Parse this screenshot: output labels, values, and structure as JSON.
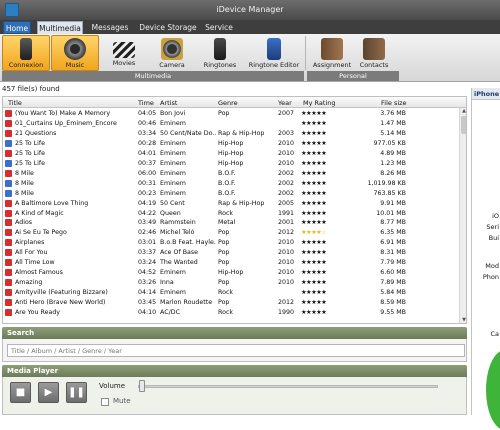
{
  "window": {
    "title": "iDevice Manager"
  },
  "menu": {
    "tabs": [
      "Home",
      "Multimedia",
      "Messages",
      "Device Storage",
      "Service"
    ],
    "active": "Multimedia"
  },
  "ribbon": {
    "buttons": [
      {
        "label": "Connexion",
        "icon": "phone-icon",
        "selected": true
      },
      {
        "label": "Music",
        "icon": "speaker-icon",
        "selected": true
      },
      {
        "label": "Movies",
        "icon": "clapperboard-icon",
        "selected": false
      },
      {
        "label": "Camera",
        "icon": "camera-icon",
        "selected": false
      },
      {
        "label": "Ringtones",
        "icon": "ringtone-phone-icon",
        "selected": false
      },
      {
        "label": "Ringtone Editor",
        "icon": "ringtone-editor-icon",
        "selected": false
      },
      {
        "label": "Assignment",
        "icon": "assignment-book-icon",
        "selected": false
      },
      {
        "label": "Contacts",
        "icon": "contacts-book-icon",
        "selected": false
      }
    ],
    "groups": {
      "multimedia": "Multimedia",
      "personal": "Personal"
    }
  },
  "list": {
    "count_text": "457 file(s) found",
    "columns": [
      "Title",
      "Time",
      "Artist",
      "Genre",
      "Year",
      "My Rating",
      "File size"
    ],
    "rows": [
      {
        "type": "video",
        "title": "(You Want To) Make A Memory",
        "time": "04:05",
        "artist": "Bon Jovi",
        "genre": "Pop",
        "year": "2007",
        "rating": 0,
        "size": "3.76 MB"
      },
      {
        "type": "video",
        "title": "01_Curtains Up_Eminem_Encore",
        "time": "00:46",
        "artist": "Eminem",
        "genre": "",
        "year": "",
        "rating": 0,
        "size": "1.47 MB"
      },
      {
        "type": "video",
        "title": "21 Questions",
        "time": "03:34",
        "artist": "50 Cent/Nate Do...",
        "genre": "Rap & Hip-Hop",
        "year": "2003",
        "rating": 0,
        "size": "5.14 MB"
      },
      {
        "type": "audio",
        "title": "25 To Life",
        "time": "00:28",
        "artist": "Eminem",
        "genre": "Hip-Hop",
        "year": "2010",
        "rating": 0,
        "size": "977.05 KB"
      },
      {
        "type": "video",
        "title": "25 To Life",
        "time": "04:01",
        "artist": "Eminem",
        "genre": "Hip-Hop",
        "year": "2010",
        "rating": 0,
        "size": "4.89 MB"
      },
      {
        "type": "audio",
        "title": "25 To Life",
        "time": "00:37",
        "artist": "Eminem",
        "genre": "Hip-Hop",
        "year": "2010",
        "rating": 0,
        "size": "1.23 MB"
      },
      {
        "type": "video",
        "title": "8 Mile",
        "time": "06:00",
        "artist": "Eminem",
        "genre": "B.O.F.",
        "year": "2002",
        "rating": 0,
        "size": "8.26 MB"
      },
      {
        "type": "audio",
        "title": "8 Mile",
        "time": "00:31",
        "artist": "Eminem",
        "genre": "B.O.F.",
        "year": "2002",
        "rating": 0,
        "size": "1,019.98 KB"
      },
      {
        "type": "audio",
        "title": "8 Mile",
        "time": "00:23",
        "artist": "Eminem",
        "genre": "B.O.F.",
        "year": "2002",
        "rating": 0,
        "size": "763.85 KB"
      },
      {
        "type": "video",
        "title": "A Baltimore Love Thing",
        "time": "04:19",
        "artist": "50 Cent",
        "genre": "Rap & Hip-Hop",
        "year": "2005",
        "rating": 0,
        "size": "9.91 MB"
      },
      {
        "type": "video",
        "title": "A Kind of Magic",
        "time": "04:22",
        "artist": "Queen",
        "genre": "Rock",
        "year": "1991",
        "rating": 0,
        "size": "10.01 MB"
      },
      {
        "type": "video",
        "title": "Adios",
        "time": "03:49",
        "artist": "Rammstein",
        "genre": "Metal",
        "year": "2001",
        "rating": 0,
        "size": "8.77 MB"
      },
      {
        "type": "video",
        "title": "Ai Se Eu Te Pego",
        "time": "02:46",
        "artist": "Michel Teló",
        "genre": "Pop",
        "year": "2012",
        "rating": 4,
        "size": "6.35 MB"
      },
      {
        "type": "video",
        "title": "Airplanes",
        "time": "03:01",
        "artist": "B.o.B Feat. Hayle...",
        "genre": "Pop",
        "year": "2010",
        "rating": 0,
        "size": "6.91 MB"
      },
      {
        "type": "video",
        "title": "All For You",
        "time": "03:37",
        "artist": "Ace Of Base",
        "genre": "Pop",
        "year": "2010",
        "rating": 0,
        "size": "8.31 MB"
      },
      {
        "type": "video",
        "title": "All Time Low",
        "time": "03:24",
        "artist": "The Wanted",
        "genre": "Pop",
        "year": "2010",
        "rating": 0,
        "size": "7.79 MB"
      },
      {
        "type": "video",
        "title": "Almost Famous",
        "time": "04:52",
        "artist": "Eminem",
        "genre": "Hip-Hop",
        "year": "2010",
        "rating": 0,
        "size": "6.60 MB"
      },
      {
        "type": "video",
        "title": "Amazing",
        "time": "03:26",
        "artist": "Inna",
        "genre": "Pop",
        "year": "2010",
        "rating": 0,
        "size": "7.89 MB"
      },
      {
        "type": "video",
        "title": "Amityville (Featuring Bizzare)",
        "time": "04:14",
        "artist": "Eminem",
        "genre": "Rock",
        "year": "",
        "rating": 0,
        "size": "5.84 MB"
      },
      {
        "type": "video",
        "title": "Anti Hero (Brave New World)",
        "time": "03:45",
        "artist": "Marlon Roudette",
        "genre": "Pop",
        "year": "2012",
        "rating": 0,
        "size": "8.59 MB"
      },
      {
        "type": "video",
        "title": "Are You Ready",
        "time": "04:10",
        "artist": "AC/DC",
        "genre": "Rock",
        "year": "1990",
        "rating": 0,
        "size": "9.55 MB"
      }
    ]
  },
  "search": {
    "heading": "Search",
    "placeholder": "Title / Album / Artist / Genre / Year"
  },
  "player": {
    "heading": "Media Player",
    "volume_label": "Volume",
    "mute_label": "Mute",
    "volume_level": 0,
    "muted": false
  },
  "right_panel": {
    "heading": "iPhone",
    "lines": [
      "iO",
      "Seri",
      "Bui",
      "Mod",
      "Phon",
      "Ca"
    ]
  },
  "colors": {
    "accent_selected": "#f1a51d",
    "section_bar": "#6c7c58",
    "rating_gold": "#f2b51c",
    "rating_empty": "#b9b9b9",
    "video_icon": "#d92c2c",
    "audio_icon": "#3a6fd0"
  }
}
